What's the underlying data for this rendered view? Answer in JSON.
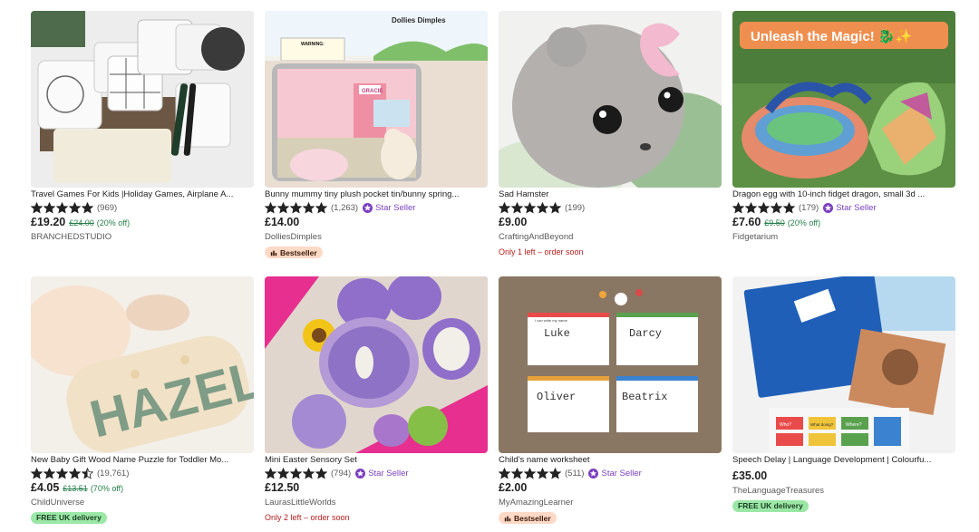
{
  "listings": [
    {
      "title": "Travel Games For Kids |Holiday Games, Airplane A...",
      "rating": 5,
      "reviews": "(969)",
      "star_seller": false,
      "star_seller_label": "",
      "price": "£19.20",
      "original_price": "£24.00",
      "discount": "(20% off)",
      "shop": "BRANCHEDSTUDIO",
      "extra": ""
    },
    {
      "title": "Bunny mummy tiny plush pocket tin/bunny spring...",
      "rating": 5,
      "reviews": "(1,263)",
      "star_seller": true,
      "star_seller_label": "Star Seller",
      "price": "£14.00",
      "original_price": "",
      "discount": "",
      "shop": "DolliesDimples",
      "extra": "Bestseller",
      "image_text": {
        "header": "Dollies Dimples",
        "warning": "WARNING:",
        "tin_name": "GRACIE"
      }
    },
    {
      "title": "Sad Hamster",
      "rating": 5,
      "reviews": "(199)",
      "star_seller": false,
      "star_seller_label": "",
      "price": "£9.00",
      "original_price": "",
      "discount": "",
      "shop": "CraftingAndBeyond",
      "extra": "Only 1 left – order soon"
    },
    {
      "title": "Dragon egg with 10-inch fidget dragon, small 3d ...",
      "rating": 5,
      "reviews": "(179)",
      "star_seller": true,
      "star_seller_label": "Star Seller",
      "price": "£7.60",
      "original_price": "£9.50",
      "discount": "(20% off)",
      "shop": "Fidgetarium",
      "extra": "",
      "image_text": {
        "banner": "Unleash the Magic! 🐉✨"
      }
    },
    {
      "title": "New Baby Gift Wood Name Puzzle for Toddler Mo...",
      "rating": 4.5,
      "reviews": "(19,761)",
      "star_seller": false,
      "star_seller_label": "",
      "price": "£4.05",
      "original_price": "£13.51",
      "discount": "(70% off)",
      "shop": "ChildUniverse",
      "extra": "FREE UK delivery",
      "image_text": {
        "puzzle": "HAZEL"
      }
    },
    {
      "title": "Mini Easter Sensory Set",
      "rating": 5,
      "reviews": "(794)",
      "star_seller": true,
      "star_seller_label": "Star Seller",
      "price": "£12.50",
      "original_price": "",
      "discount": "",
      "shop": "LaurasLittleWorlds",
      "extra": "Only 2 left – order soon"
    },
    {
      "title": "Child's name worksheet",
      "rating": 5,
      "reviews": "(511)",
      "star_seller": true,
      "star_seller_label": "Star Seller",
      "price": "£2.00",
      "original_price": "",
      "discount": "",
      "shop": "MyAmazingLearner",
      "extra": "Bestseller",
      "image_text": {
        "caption": "I can write my name",
        "names": [
          "Luke",
          "Darcy",
          "Oliver",
          "Beatrix"
        ]
      }
    },
    {
      "title": "Speech Delay | Language Development | Colourfu...",
      "rating": 0,
      "reviews": "",
      "star_seller": false,
      "star_seller_label": "",
      "price": "£35.00",
      "original_price": "",
      "discount": "",
      "shop": "TheLanguageTreasures",
      "extra": "FREE UK delivery",
      "image_text": {
        "cards": [
          "Who?",
          "What doing?",
          "Where?"
        ]
      }
    }
  ],
  "colors": {
    "star": "#222222",
    "star_seller": "#7b3fbf",
    "discount": "#257e4a",
    "urgent": "#b71c1c",
    "bestseller_bg": "#fdd9c6",
    "delivery_bg": "#9be7a6"
  },
  "icons": {
    "rating": "star-icon",
    "star_seller": "star-seller-badge-icon",
    "bestseller": "bestseller-icon"
  }
}
